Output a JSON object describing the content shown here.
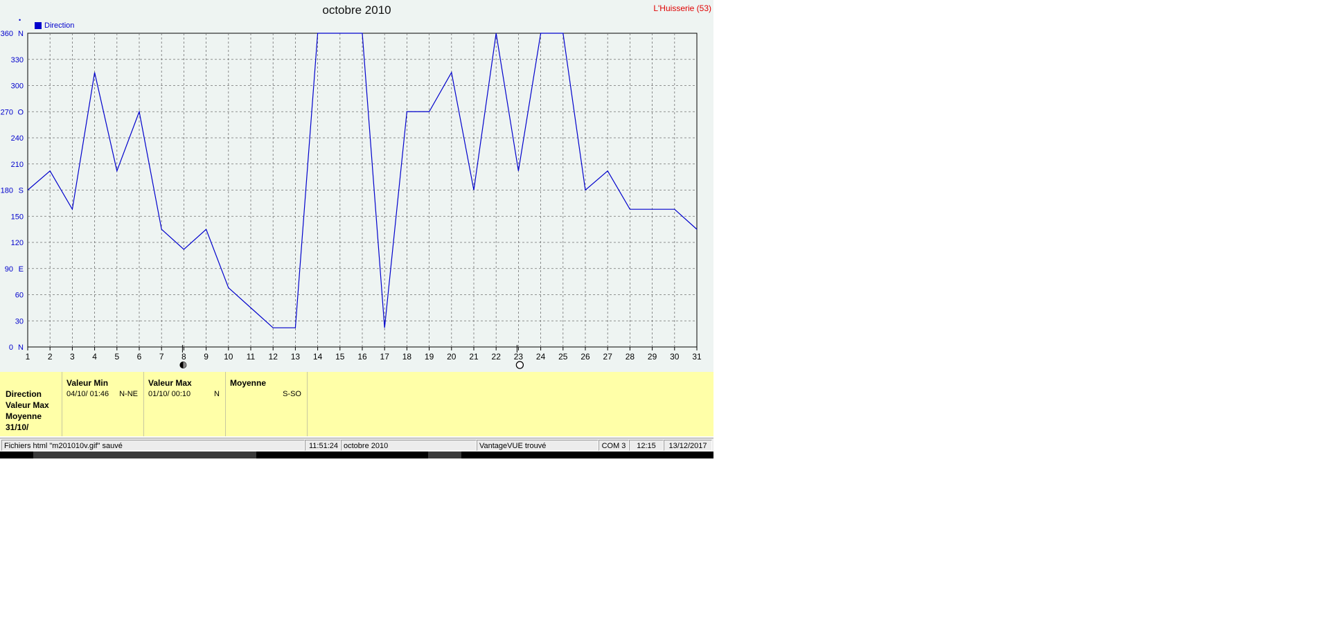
{
  "chart_data": {
    "type": "line",
    "title": "octobre 2010",
    "station": "L'Huisserie (53)",
    "legend": "Direction",
    "legend_placement": "top-left",
    "grid": true,
    "xlim": [
      1,
      31
    ],
    "ylim": [
      0,
      360
    ],
    "x": [
      1,
      2,
      3,
      4,
      5,
      6,
      7,
      8,
      9,
      10,
      11,
      12,
      13,
      14,
      15,
      16,
      17,
      18,
      19,
      20,
      21,
      22,
      23,
      24,
      25,
      26,
      27,
      28,
      29,
      30,
      31
    ],
    "x_ticks": [
      "1",
      "2",
      "3",
      "4",
      "5",
      "6",
      "7",
      "8",
      "9",
      "10",
      "11",
      "12",
      "13",
      "14",
      "15",
      "16",
      "17",
      "18",
      "19",
      "20",
      "21",
      "22",
      "23",
      "24",
      "25",
      "26",
      "27",
      "28",
      "29",
      "30",
      "31"
    ],
    "y_ticks": [
      {
        "v": 0,
        "label": "0",
        "dir": "N"
      },
      {
        "v": 30,
        "label": "30",
        "dir": ""
      },
      {
        "v": 60,
        "label": "60",
        "dir": ""
      },
      {
        "v": 90,
        "label": "90",
        "dir": "E"
      },
      {
        "v": 120,
        "label": "120",
        "dir": ""
      },
      {
        "v": 150,
        "label": "150",
        "dir": ""
      },
      {
        "v": 180,
        "label": "180",
        "dir": "S"
      },
      {
        "v": 210,
        "label": "210",
        "dir": ""
      },
      {
        "v": 240,
        "label": "240",
        "dir": ""
      },
      {
        "v": 270,
        "label": "270",
        "dir": "O"
      },
      {
        "v": 300,
        "label": "300",
        "dir": ""
      },
      {
        "v": 330,
        "label": "330",
        "dir": ""
      },
      {
        "v": 360,
        "label": "360",
        "dir": "N"
      }
    ],
    "series": [
      {
        "name": "Direction",
        "color": "#0000cc",
        "values": [
          180,
          202,
          158,
          315,
          202,
          270,
          135,
          112,
          135,
          68,
          45,
          22,
          22,
          360,
          360,
          360,
          22,
          270,
          270,
          315,
          180,
          360,
          202,
          360,
          360,
          180,
          202,
          158,
          158,
          158,
          135
        ]
      }
    ],
    "moon_markers": [
      {
        "x": 8,
        "phase": "last-quarter"
      },
      {
        "x": 23,
        "phase": "full"
      }
    ]
  },
  "stats": {
    "row_labels": [
      "Direction",
      "Valeur Max",
      "Moyenne",
      "31/10/"
    ],
    "min": {
      "head": "Valeur Min",
      "date": "04/10/  01:46",
      "dir": "N-NE"
    },
    "max": {
      "head": "Valeur Max",
      "date": "01/10/  00:10",
      "dir": "N"
    },
    "avg": {
      "head": "Moyenne",
      "dir": "S-SO"
    }
  },
  "status": {
    "file": "Fichiers html  \"m201010v.gif\"  sauvé",
    "time1": "11:51:24",
    "month": "octobre 2010",
    "station_status": "VantageVUE trouvé",
    "port": "COM 3",
    "time2": "12:15",
    "date": "13/12/2017"
  },
  "colors": {
    "plot_bg": "#eef4f2",
    "line": "#0000cc",
    "axis_label": "#0000cc",
    "grid": "#808080",
    "stats_bg": "#ffffa8"
  }
}
